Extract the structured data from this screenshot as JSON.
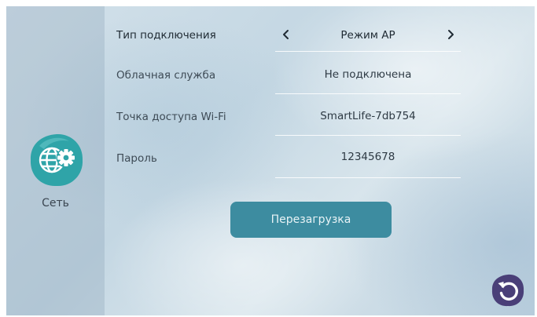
{
  "sidebar": {
    "icon": "network-settings-icon",
    "label": "Сеть",
    "accent": "#2fa4a8"
  },
  "settings": {
    "connection_type": {
      "label": "Тип подключения",
      "value": "Режим AP"
    },
    "cloud_service": {
      "label": "Облачная служба",
      "value": "Не подключена"
    },
    "wifi_ap": {
      "label": "Точка доступа Wi-Fi",
      "value": "SmartLife-7db754"
    },
    "password": {
      "label": "Пароль",
      "value": "12345678"
    }
  },
  "reboot_button": {
    "label": "Перезагрузка",
    "color": "#3d8ca0"
  },
  "back_button": {
    "icon": "undo-arrow-icon",
    "color": "#4a3f78"
  }
}
